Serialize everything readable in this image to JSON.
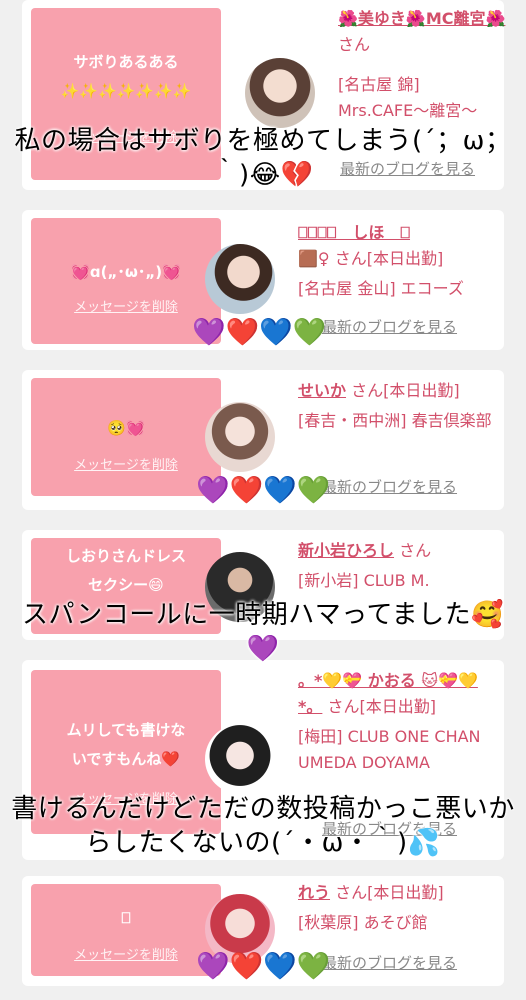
{
  "colors": {
    "page_bg": "#f0f0f0",
    "card_bg": "#ffffff",
    "message_box_bg": "#f8a1ad",
    "accent_pink": "#d24f6a",
    "blog_link_gray": "#888888"
  },
  "common": {
    "delete_label": "メッセージを削除",
    "blog_label": "最新のブログを見る"
  },
  "cards": [
    {
      "message": "サボりあるある\n✨✨✨✨✨✨✨",
      "name": "🌺美ゆき🌺MC離宮🌺",
      "suffix": " さん",
      "shop": "[名古屋 錦] Mrs.CAFE〜離宮〜",
      "hearts": ""
    },
    {
      "message": "💓ɑ(„･ω･„)💓",
      "name": "⎕⎕⎕⎕　しほ　⎕",
      "suffix": "🟫♀ さん[本日出勤]",
      "shop": "[名古屋 金山] エコーズ",
      "hearts": "💜❤️💙💚"
    },
    {
      "message": "🥺💓",
      "name": "せいか",
      "suffix": " さん[本日出勤]",
      "shop": "[春吉・西中洲] 春吉倶楽部",
      "hearts": "💜❤️💙💚"
    },
    {
      "message": "しおりさんドレス\nセクシー😄",
      "name": "新小岩ひろし",
      "suffix": " さん",
      "shop": "[新小岩] CLUB M.",
      "hearts": ""
    },
    {
      "message": "ムリしても書けな\nいですもんね❤️",
      "name": "。*💛💝 かおる 🐱💝💛*。",
      "suffix": " さん[本日出勤]",
      "shop": "[梅田] CLUB ONE CHAN UMEDA DOYAMA",
      "hearts": ""
    },
    {
      "message": "⎕",
      "name": "れう",
      "suffix": " さん[本日出勤]",
      "shop": "[秋葉原] あそび館",
      "hearts": "💜❤️💙💚"
    }
  ],
  "captions": [
    "私の場合はサボりを極めてしまう(´；ω；｀)😂💔",
    "スパンコールに一時期ハマってました🥰💜",
    "書けるんだけどただの数投稿かっこ悪いからしたくないの(´・ω・｀)💦"
  ]
}
